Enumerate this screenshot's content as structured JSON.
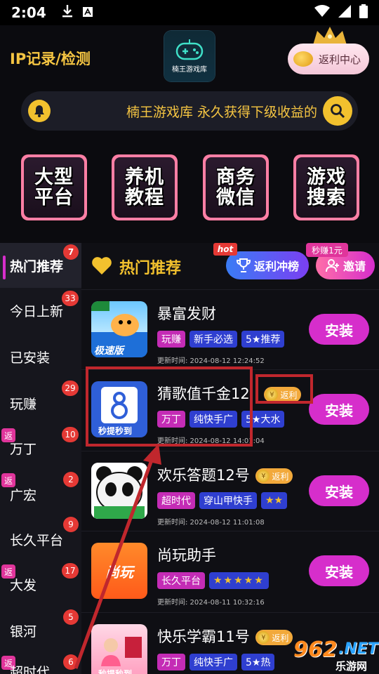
{
  "status_bar": {
    "time": "2:04"
  },
  "header": {
    "ip_link": "IP记录/检测",
    "logo_text": "楠王游戏库",
    "rebate_center": "返利中心",
    "marquee": "楠王游戏库 永久获得下级收益的"
  },
  "menu_tiles": [
    {
      "line1": "大型",
      "line2": "平台"
    },
    {
      "line1": "养机",
      "line2": "教程"
    },
    {
      "line1": "商务",
      "line2": "微信"
    },
    {
      "line1": "游戏",
      "line2": "搜索"
    }
  ],
  "sidebar": {
    "items": [
      {
        "label": "热门推荐",
        "count": "7",
        "fan": ""
      },
      {
        "label": "今日上新",
        "count": "33",
        "fan": ""
      },
      {
        "label": "已安装",
        "count": "",
        "fan": ""
      },
      {
        "label": "玩赚",
        "count": "29",
        "fan": ""
      },
      {
        "label": "万丁",
        "count": "10",
        "fan": "返"
      },
      {
        "label": "广宏",
        "count": "2",
        "fan": "返"
      },
      {
        "label": "长久平台",
        "count": "9",
        "fan": ""
      },
      {
        "label": "大发",
        "count": "17",
        "fan": "返"
      },
      {
        "label": "银河",
        "count": "5",
        "fan": ""
      },
      {
        "label": "超时代",
        "count": "6",
        "fan": "返"
      }
    ]
  },
  "main": {
    "title": "热门推荐",
    "hot_tag": "hot",
    "rank_button": "返利冲榜",
    "miao_tag": "秒赚1元",
    "invite_button": "邀请",
    "apps": [
      {
        "name": "暴富发财",
        "rebate": "",
        "tags": [
          {
            "text": "玩赚",
            "color": "pink"
          },
          {
            "text": "新手必选",
            "color": "blue"
          },
          {
            "text": "5★推荐",
            "color": "blue"
          }
        ],
        "time": "更新时间: 2024-08-12 12:24:52",
        "install": "安装",
        "icon_label": "极速版"
      },
      {
        "name": "猜歌值千金12",
        "rebate": "返利",
        "tags": [
          {
            "text": "万丁",
            "color": "pink"
          },
          {
            "text": "纯快手广",
            "color": "blue"
          },
          {
            "text": "5★大水",
            "color": "blue"
          }
        ],
        "time": "更新时间: 2024-08-12 14:01:04",
        "install": "安装",
        "icon_label": "秒提秒到"
      },
      {
        "name": "欢乐答题12号",
        "rebate": "返利",
        "tags": [
          {
            "text": "超时代",
            "color": "pink"
          },
          {
            "text": "穿山甲快手",
            "color": "blue"
          },
          {
            "text": "★★",
            "color": "blue"
          }
        ],
        "time": "更新时间: 2024-08-12 11:01:08",
        "install": "安装",
        "icon_label": ""
      },
      {
        "name": "尚玩助手",
        "rebate": "",
        "tags": [
          {
            "text": "长久平台",
            "color": "pink"
          },
          {
            "text": "★★★★★",
            "color": "blue"
          }
        ],
        "time": "更新时间: 2024-08-11 10:32:16",
        "install": "安装",
        "icon_label": "尚玩"
      },
      {
        "name": "快乐学霸11号",
        "rebate": "返利",
        "tags": [
          {
            "text": "万丁",
            "color": "pink"
          },
          {
            "text": "纯快手广",
            "color": "blue"
          },
          {
            "text": "5★热",
            "color": "blue"
          }
        ],
        "time": "",
        "install": "安装",
        "icon_label": "秒提秒到"
      }
    ]
  },
  "watermark": {
    "num": "962",
    "net": ".NET",
    "site": "乐游网"
  },
  "colors": {
    "accent_gold": "#f2c12e",
    "install_pink": "#d62ecb",
    "annotation_red": "#c0272d"
  }
}
